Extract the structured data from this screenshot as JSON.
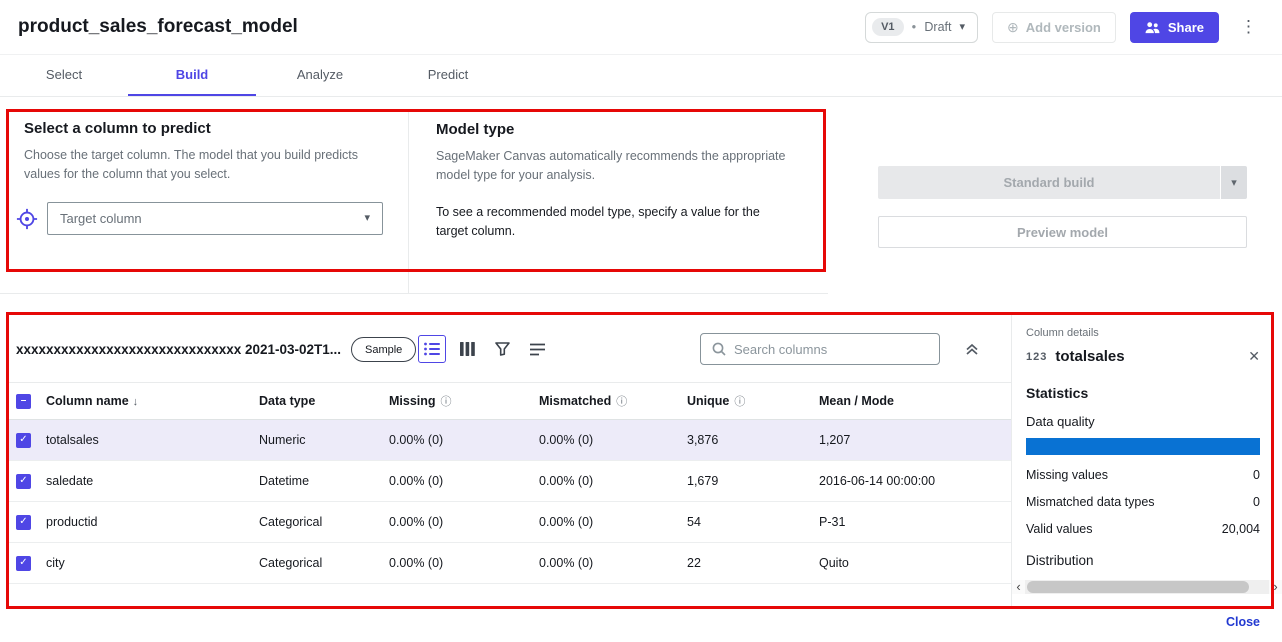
{
  "colors": {
    "accent": "#4f46e5",
    "annotation": "#e60807",
    "quality-bar": "#0972d3",
    "row-highlight": "#edebf9",
    "link": "#2239d1"
  },
  "icons": {
    "status_dot": "●",
    "caret_down": "▾",
    "plus_circle": "⊕",
    "kebab": "⋮",
    "check": "✓",
    "indeterminate": "–",
    "sort_down": "↓",
    "info": "ⓘ",
    "close": "✕",
    "scroll_left": "‹",
    "scroll_right": "›"
  },
  "header": {
    "title": "product_sales_forecast_model",
    "version_badge": "V1",
    "version_status": "Draft",
    "add_version_label": "Add version",
    "share_label": "Share"
  },
  "tabs": [
    {
      "label": "Select"
    },
    {
      "label": "Build"
    },
    {
      "label": "Analyze"
    },
    {
      "label": "Predict"
    }
  ],
  "target_panel": {
    "title": "Select a column to predict",
    "description": "Choose the target column. The model that you build predicts values for the column that you select.",
    "dropdown_placeholder": "Target column"
  },
  "model_panel": {
    "title": "Model type",
    "description": "SageMaker Canvas automatically recommends the appropriate model type for your analysis.",
    "note": "To see a recommended model type, specify a value for the target column."
  },
  "build_actions": {
    "standard_build_label": "Standard build",
    "preview_model_label": "Preview model"
  },
  "grid_toolbar": {
    "dataset_name": "xxxxxxxxxxxxxxxxxxxxxxxxxxxxxx 2021-03-02T1...",
    "sample_label": "Sample",
    "search_placeholder": "Search columns"
  },
  "table": {
    "headers": {
      "column_name": "Column name",
      "data_type": "Data type",
      "missing": "Missing",
      "mismatched": "Mismatched",
      "unique": "Unique",
      "mean_mode": "Mean / Mode"
    },
    "rows": [
      {
        "column_name": "totalsales",
        "data_type": "Numeric",
        "missing": "0.00% (0)",
        "mismatched": "0.00% (0)",
        "unique": "3,876",
        "mean_mode": "1,207"
      },
      {
        "column_name": "saledate",
        "data_type": "Datetime",
        "missing": "0.00% (0)",
        "mismatched": "0.00% (0)",
        "unique": "1,679",
        "mean_mode": "2016-06-14 00:00:00"
      },
      {
        "column_name": "productid",
        "data_type": "Categorical",
        "missing": "0.00% (0)",
        "mismatched": "0.00% (0)",
        "unique": "54",
        "mean_mode": "P-31"
      },
      {
        "column_name": "city",
        "data_type": "Categorical",
        "missing": "0.00% (0)",
        "mismatched": "0.00% (0)",
        "unique": "22",
        "mean_mode": "Quito"
      }
    ]
  },
  "column_details": {
    "panel_title": "Column details",
    "type_badge": "123",
    "column_name": "totalsales",
    "statistics_title": "Statistics",
    "data_quality_label": "Data quality",
    "stats": [
      {
        "label": "Missing values",
        "value": "0"
      },
      {
        "label": "Mismatched data types",
        "value": "0"
      },
      {
        "label": "Valid values",
        "value": "20,004"
      }
    ],
    "distribution_label": "Distribution"
  },
  "footer": {
    "close_label": "Close"
  }
}
